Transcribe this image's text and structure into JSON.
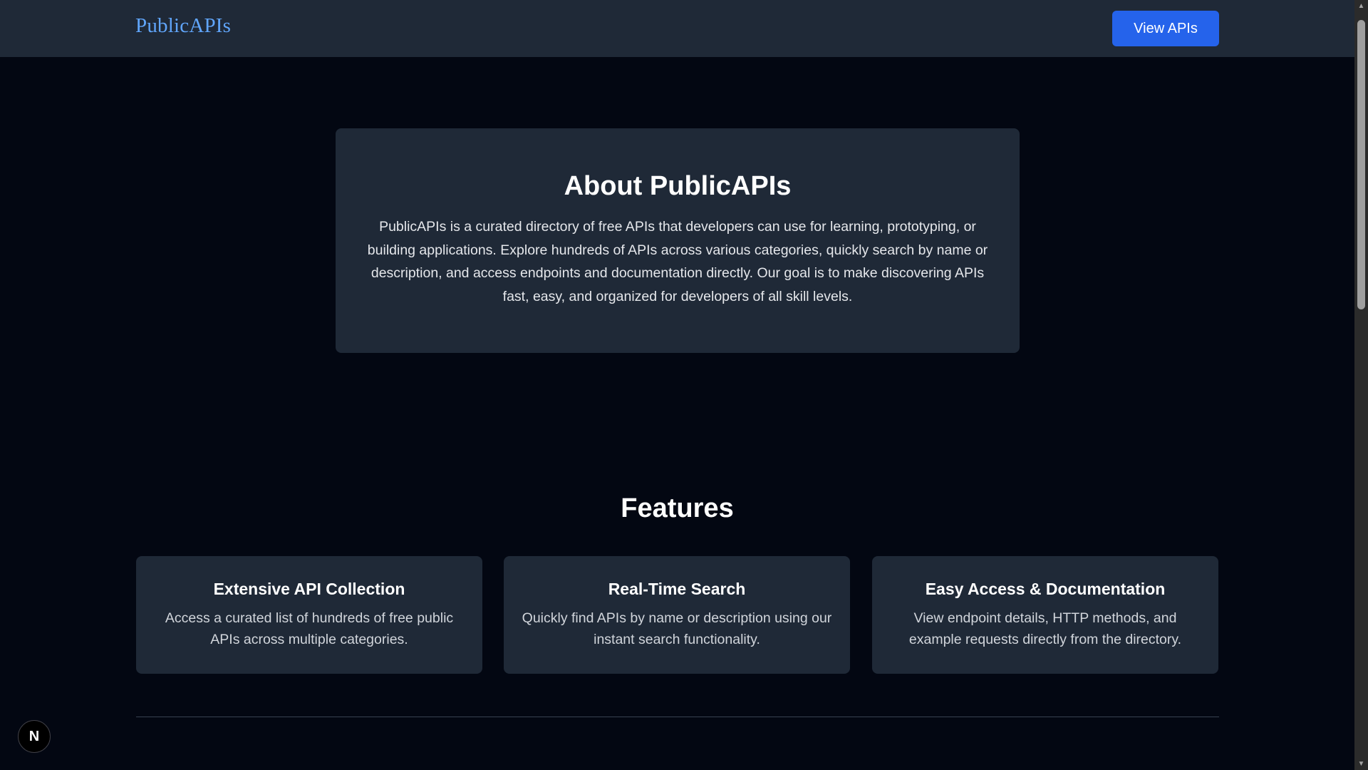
{
  "header": {
    "brand": "PublicAPIs",
    "view_button_label": "View APIs"
  },
  "about": {
    "title": "About PublicAPIs",
    "text": "PublicAPIs is a curated directory of free APIs that developers can use for learning, prototyping, or building applications. Explore hundreds of APIs across various categories, quickly search by name or description, and access endpoints and documentation directly. Our goal is to make discovering APIs fast, easy, and organized for developers of all skill levels."
  },
  "features": {
    "title": "Features",
    "items": [
      {
        "title": "Extensive API Collection",
        "text": "Access a curated list of hundreds of free public APIs across multiple categories."
      },
      {
        "title": "Real-Time Search",
        "text": "Quickly find APIs by name or description using our instant search functionality."
      },
      {
        "title": "Easy Access & Documentation",
        "text": "View endpoint details, HTTP methods, and example requests directly from the directory."
      }
    ]
  },
  "dev_indicator": {
    "label": "N"
  },
  "scrollbar": {
    "up_arrow": "▲",
    "down_arrow": "▼"
  },
  "colors": {
    "page_background": "#030712",
    "surface": "#1f2937",
    "accent": "#2563eb",
    "brand": "#60a5fa"
  }
}
